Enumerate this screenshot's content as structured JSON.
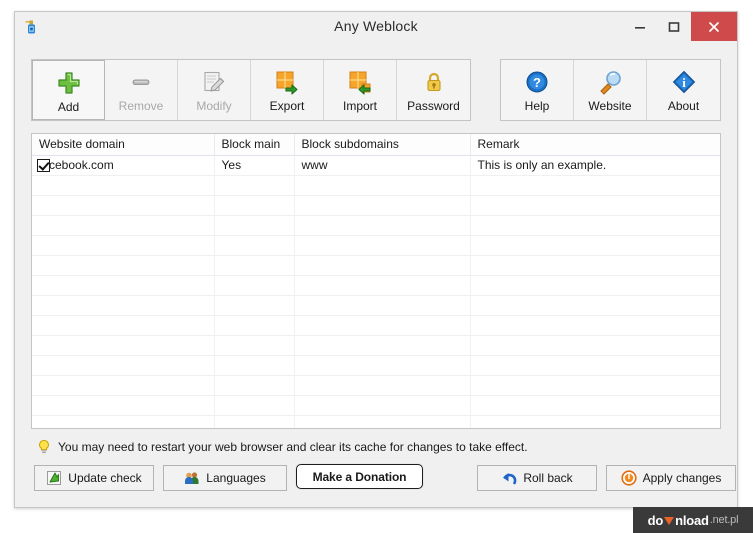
{
  "window": {
    "title": "Any Weblock",
    "app_icon": "spray-bottle-icon",
    "caption": {
      "minimize": "minimize-icon",
      "maximize": "maximize-icon",
      "close": "close-icon",
      "close_color": "#cf4b4b"
    }
  },
  "toolbar": {
    "main_buttons": [
      {
        "label": "Add",
        "icon": "green-plus-icon",
        "disabled": false,
        "selected": true
      },
      {
        "label": "Remove",
        "icon": "gray-minus-icon",
        "disabled": true,
        "selected": false
      },
      {
        "label": "Modify",
        "icon": "pencil-page-icon",
        "disabled": true,
        "selected": false
      },
      {
        "label": "Export",
        "icon": "export-arrow-icon",
        "disabled": false,
        "selected": false
      },
      {
        "label": "Import",
        "icon": "import-arrow-icon",
        "disabled": false,
        "selected": false
      },
      {
        "label": "Password",
        "icon": "padlock-icon",
        "disabled": false,
        "selected": false
      }
    ],
    "help_buttons": [
      {
        "label": "Help",
        "icon": "question-mark-icon"
      },
      {
        "label": "Website",
        "icon": "magnifier-icon"
      },
      {
        "label": "About",
        "icon": "info-diamond-icon"
      }
    ]
  },
  "table": {
    "columns": [
      "Website domain",
      "Block main",
      "Block subdomains",
      "Remark"
    ],
    "rows": [
      {
        "checked": true,
        "domain": "facebook.com",
        "block_main": "Yes",
        "block_subdomains": "www",
        "remark": "This is only an example."
      }
    ],
    "empty_row_count": 13
  },
  "hint": {
    "icon": "lightbulb-icon",
    "text": "You may need to restart your web browser and clear its cache for changes to take effect."
  },
  "bottom_buttons": {
    "update_check": {
      "label": "Update check",
      "icon": "green-arrow-icon"
    },
    "languages": {
      "label": "Languages",
      "icon": "people-icon"
    },
    "donation": {
      "label": "Make a Donation"
    },
    "roll_back": {
      "label": "Roll back",
      "icon": "blue-undo-arrow-icon"
    },
    "apply_changes": {
      "label": "Apply changes",
      "icon": "orange-circle-icon"
    }
  },
  "watermark": {
    "part1": "do",
    "glyph": "orange-down-arrow-icon",
    "part2": "nload",
    "tld": ".net.pl",
    "accent": "#e8622a"
  }
}
